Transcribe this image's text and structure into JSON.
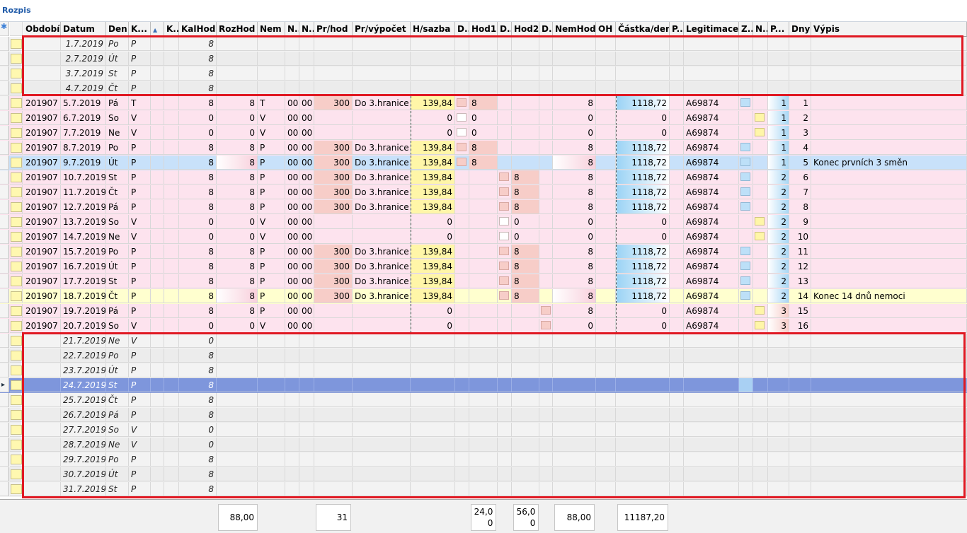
{
  "panel_title": "Rozpis",
  "colors": {
    "pink_row": "#fde3ee",
    "gray_row": "#efefef",
    "selected_row": "#c8e1fa",
    "selected_empty_row": "#7e96dc",
    "yellow_row": "#ffffcf",
    "red_highlight": "#e01822"
  },
  "columns": [
    "Období",
    "Datum",
    "Den",
    "K...",
    "",
    "K..",
    "KalHod",
    "RozHod",
    "Nem",
    "N..",
    "N..",
    "Pr/hod",
    "Pr/výpočet",
    "H/sazba",
    "D..",
    "Hod1",
    "D..",
    "Hod2",
    "D..",
    "NemHod",
    "OH",
    "Částka/den",
    "P..",
    "Legitimace",
    "Z..",
    "N..",
    "P...",
    "Dny",
    "Výpis"
  ],
  "new_row_icon": "✱",
  "sort_icon": "▲",
  "rows_top": [
    {
      "datum": "1.7.2019",
      "den": "Po",
      "k": "P",
      "kal": "8"
    },
    {
      "datum": "2.7.2019",
      "den": "Út",
      "k": "P",
      "kal": "8"
    },
    {
      "datum": "3.7.2019",
      "den": "St",
      "k": "P",
      "kal": "8"
    },
    {
      "datum": "4.7.2019",
      "den": "Čt",
      "k": "P",
      "kal": "8"
    }
  ],
  "rows_main": [
    {
      "obd": "201907",
      "datum": "5.7.2019",
      "den": "Pá",
      "k": "T",
      "kal": "8",
      "roz": "8",
      "nem": "T",
      "n1": "00",
      "n2": "00",
      "prhod": "300",
      "prv": "Do 3.hranice",
      "hs": "139,84",
      "hod1": "8",
      "hod2": "",
      "nh": "8",
      "castka": "1118,72",
      "leg": "A69874",
      "p": "1",
      "dny": "1",
      "vypis": "",
      "style": "pink"
    },
    {
      "obd": "201907",
      "datum": "6.7.2019",
      "den": "So",
      "k": "V",
      "kal": "0",
      "roz": "0",
      "nem": "V",
      "n1": "00",
      "n2": "00",
      "prhod": "",
      "prv": "",
      "hs": "0",
      "hod1": "0",
      "hod2": "",
      "nh": "0",
      "castka": "0",
      "leg": "A69874",
      "p": "1",
      "dny": "2",
      "vypis": "",
      "style": "pink"
    },
    {
      "obd": "201907",
      "datum": "7.7.2019",
      "den": "Ne",
      "k": "V",
      "kal": "0",
      "roz": "0",
      "nem": "V",
      "n1": "00",
      "n2": "00",
      "prhod": "",
      "prv": "",
      "hs": "0",
      "hod1": "0",
      "hod2": "",
      "nh": "0",
      "castka": "0",
      "leg": "A69874",
      "p": "1",
      "dny": "3",
      "vypis": "",
      "style": "pink"
    },
    {
      "obd": "201907",
      "datum": "8.7.2019",
      "den": "Po",
      "k": "P",
      "kal": "8",
      "roz": "8",
      "nem": "P",
      "n1": "00",
      "n2": "00",
      "prhod": "300",
      "prv": "Do 3.hranice",
      "hs": "139,84",
      "hod1": "8",
      "hod2": "",
      "nh": "8",
      "castka": "1118,72",
      "leg": "A69874",
      "p": "1",
      "dny": "4",
      "vypis": "",
      "style": "pink"
    },
    {
      "obd": "201907",
      "datum": "9.7.2019",
      "den": "Út",
      "k": "P",
      "kal": "8",
      "roz": "8",
      "nem": "P",
      "n1": "00",
      "n2": "00",
      "prhod": "300",
      "prv": "Do 3.hranice",
      "hs": "139,84",
      "hod1": "8",
      "hod2": "",
      "nh": "8",
      "castka": "1118,72",
      "leg": "A69874",
      "p": "1",
      "dny": "5",
      "vypis": "Konec prvních 3 směn",
      "style": "blue"
    },
    {
      "obd": "201907",
      "datum": "10.7.2019",
      "den": "St",
      "k": "P",
      "kal": "8",
      "roz": "8",
      "nem": "P",
      "n1": "00",
      "n2": "00",
      "prhod": "300",
      "prv": "Do 3.hranice",
      "hs": "139,84",
      "hod1": "",
      "hod2": "8",
      "nh": "8",
      "castka": "1118,72",
      "leg": "A69874",
      "p": "2",
      "dny": "6",
      "vypis": "",
      "style": "pink"
    },
    {
      "obd": "201907",
      "datum": "11.7.2019",
      "den": "Čt",
      "k": "P",
      "kal": "8",
      "roz": "8",
      "nem": "P",
      "n1": "00",
      "n2": "00",
      "prhod": "300",
      "prv": "Do 3.hranice",
      "hs": "139,84",
      "hod1": "",
      "hod2": "8",
      "nh": "8",
      "castka": "1118,72",
      "leg": "A69874",
      "p": "2",
      "dny": "7",
      "vypis": "",
      "style": "pink"
    },
    {
      "obd": "201907",
      "datum": "12.7.2019",
      "den": "Pá",
      "k": "P",
      "kal": "8",
      "roz": "8",
      "nem": "P",
      "n1": "00",
      "n2": "00",
      "prhod": "300",
      "prv": "Do 3.hranice",
      "hs": "139,84",
      "hod1": "",
      "hod2": "8",
      "nh": "8",
      "castka": "1118,72",
      "leg": "A69874",
      "p": "2",
      "dny": "8",
      "vypis": "",
      "style": "pink"
    },
    {
      "obd": "201907",
      "datum": "13.7.2019",
      "den": "So",
      "k": "V",
      "kal": "0",
      "roz": "0",
      "nem": "V",
      "n1": "00",
      "n2": "00",
      "prhod": "",
      "prv": "",
      "hs": "0",
      "hod1": "",
      "hod2": "0",
      "nh": "0",
      "castka": "0",
      "leg": "A69874",
      "p": "2",
      "dny": "9",
      "vypis": "",
      "style": "pink"
    },
    {
      "obd": "201907",
      "datum": "14.7.2019",
      "den": "Ne",
      "k": "V",
      "kal": "0",
      "roz": "0",
      "nem": "V",
      "n1": "00",
      "n2": "00",
      "prhod": "",
      "prv": "",
      "hs": "0",
      "hod1": "",
      "hod2": "0",
      "nh": "0",
      "castka": "0",
      "leg": "A69874",
      "p": "2",
      "dny": "10",
      "vypis": "",
      "style": "pink"
    },
    {
      "obd": "201907",
      "datum": "15.7.2019",
      "den": "Po",
      "k": "P",
      "kal": "8",
      "roz": "8",
      "nem": "P",
      "n1": "00",
      "n2": "00",
      "prhod": "300",
      "prv": "Do 3.hranice",
      "hs": "139,84",
      "hod1": "",
      "hod2": "8",
      "nh": "8",
      "castka": "1118,72",
      "leg": "A69874",
      "p": "2",
      "dny": "11",
      "vypis": "",
      "style": "pink"
    },
    {
      "obd": "201907",
      "datum": "16.7.2019",
      "den": "Út",
      "k": "P",
      "kal": "8",
      "roz": "8",
      "nem": "P",
      "n1": "00",
      "n2": "00",
      "prhod": "300",
      "prv": "Do 3.hranice",
      "hs": "139,84",
      "hod1": "",
      "hod2": "8",
      "nh": "8",
      "castka": "1118,72",
      "leg": "A69874",
      "p": "2",
      "dny": "12",
      "vypis": "",
      "style": "pink"
    },
    {
      "obd": "201907",
      "datum": "17.7.2019",
      "den": "St",
      "k": "P",
      "kal": "8",
      "roz": "8",
      "nem": "P",
      "n1": "00",
      "n2": "00",
      "prhod": "300",
      "prv": "Do 3.hranice",
      "hs": "139,84",
      "hod1": "",
      "hod2": "8",
      "nh": "8",
      "castka": "1118,72",
      "leg": "A69874",
      "p": "2",
      "dny": "13",
      "vypis": "",
      "style": "pink"
    },
    {
      "obd": "201907",
      "datum": "18.7.2019",
      "den": "Čt",
      "k": "P",
      "kal": "8",
      "roz": "8",
      "nem": "P",
      "n1": "00",
      "n2": "00",
      "prhod": "300",
      "prv": "Do 3.hranice",
      "hs": "139,84",
      "hod1": "",
      "hod2": "8",
      "nh": "8",
      "castka": "1118,72",
      "leg": "A69874",
      "p": "2",
      "dny": "14",
      "vypis": "Konec 14 dnů nemoci",
      "style": "yellow"
    },
    {
      "obd": "201907",
      "datum": "19.7.2019",
      "den": "Pá",
      "k": "P",
      "kal": "8",
      "roz": "8",
      "nem": "P",
      "n1": "00",
      "n2": "00",
      "prhod": "",
      "prv": "",
      "hs": "0",
      "hod1": "",
      "hod2": "",
      "nh": "8",
      "castka": "0",
      "leg": "A69874",
      "p": "3",
      "dny": "15",
      "vypis": "",
      "style": "pink"
    },
    {
      "obd": "201907",
      "datum": "20.7.2019",
      "den": "So",
      "k": "V",
      "kal": "0",
      "roz": "0",
      "nem": "V",
      "n1": "00",
      "n2": "00",
      "prhod": "",
      "prv": "",
      "hs": "0",
      "hod1": "",
      "hod2": "",
      "nh": "0",
      "castka": "0",
      "leg": "A69874",
      "p": "3",
      "dny": "16",
      "vypis": "",
      "style": "pink"
    }
  ],
  "rows_bottom": [
    {
      "datum": "21.7.2019",
      "den": "Ne",
      "k": "V",
      "kal": "0"
    },
    {
      "datum": "22.7.2019",
      "den": "Po",
      "k": "P",
      "kal": "8"
    },
    {
      "datum": "23.7.2019",
      "den": "Út",
      "k": "P",
      "kal": "8"
    },
    {
      "datum": "24.7.2019",
      "den": "St",
      "k": "P",
      "kal": "8",
      "selected": true
    },
    {
      "datum": "25.7.2019",
      "den": "Čt",
      "k": "P",
      "kal": "8"
    },
    {
      "datum": "26.7.2019",
      "den": "Pá",
      "k": "P",
      "kal": "8"
    },
    {
      "datum": "27.7.2019",
      "den": "So",
      "k": "V",
      "kal": "0"
    },
    {
      "datum": "28.7.2019",
      "den": "Ne",
      "k": "V",
      "kal": "0"
    },
    {
      "datum": "29.7.2019",
      "den": "Po",
      "k": "P",
      "kal": "8"
    },
    {
      "datum": "30.7.2019",
      "den": "Út",
      "k": "P",
      "kal": "8"
    },
    {
      "datum": "31.7.2019",
      "den": "St",
      "k": "P",
      "kal": "8"
    }
  ],
  "totals": {
    "kalhod": "88,00",
    "prhod": "31",
    "hod1": "24,0\n0",
    "hod2": "56,0\n0",
    "nemhod": "88,00",
    "castka": "11187,20"
  }
}
